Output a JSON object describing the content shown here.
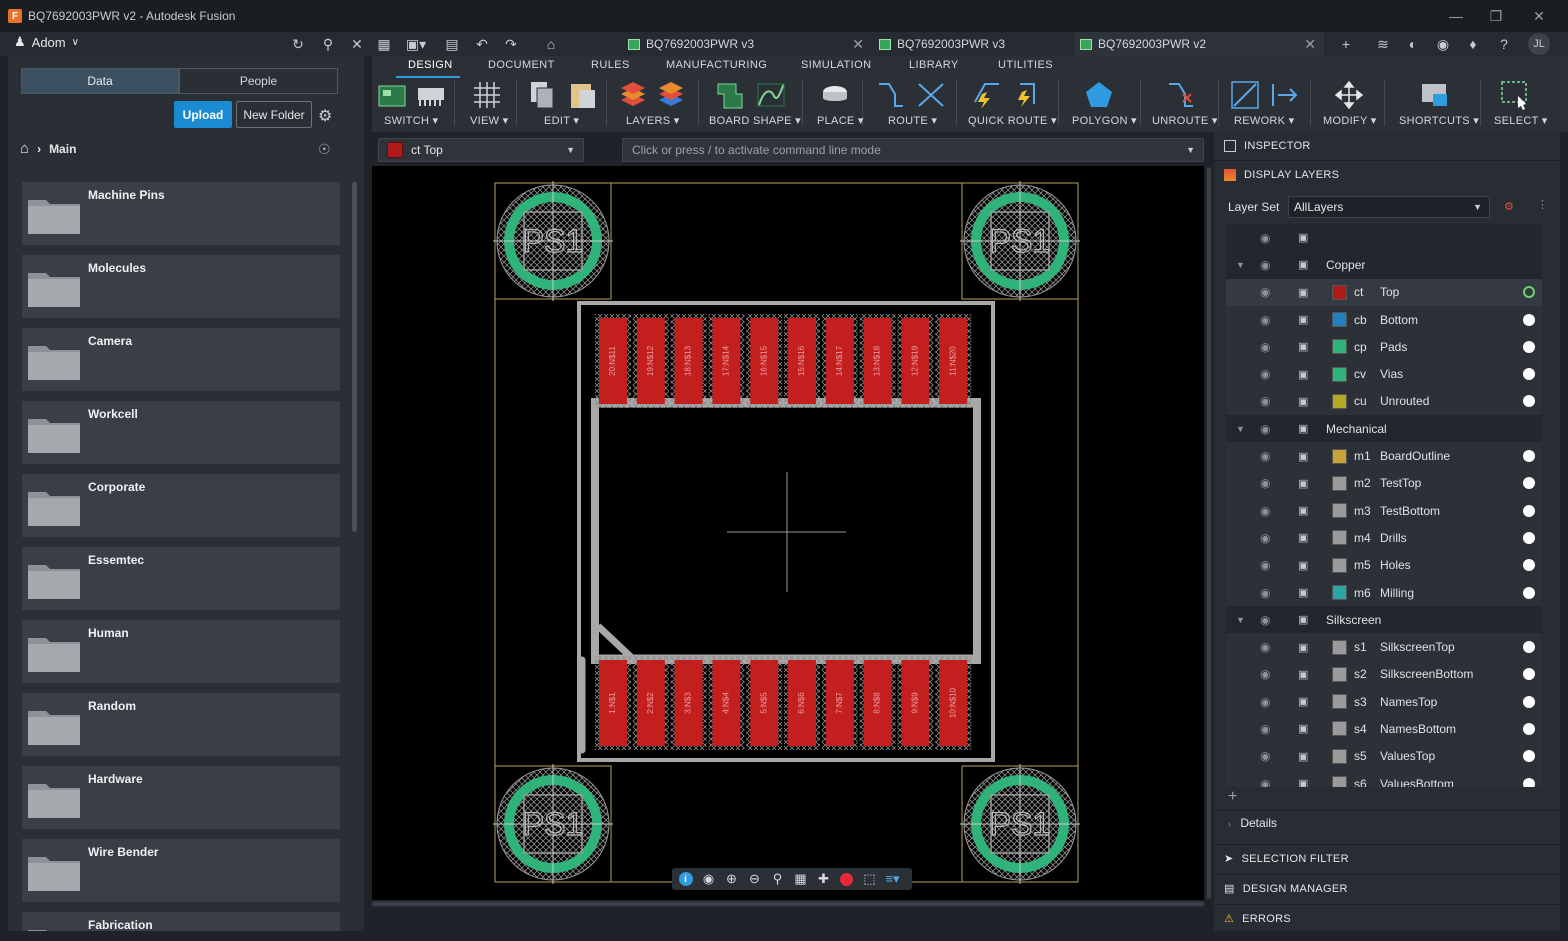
{
  "window": {
    "title": "BQ7692003PWR v2 - Autodesk Fusion"
  },
  "appbar": {
    "team": "Adom",
    "tabs": [
      {
        "label": "BQ7692003PWR v3",
        "active": false
      },
      {
        "label": "BQ7692003PWR v3",
        "active": false
      },
      {
        "label": "BQ7692003PWR v2",
        "active": true
      }
    ],
    "user_initials": "JL"
  },
  "datapanel": {
    "tab_data": "Data",
    "tab_people": "People",
    "upload": "Upload",
    "new_folder": "New Folder",
    "breadcrumb": "Main",
    "folders": [
      "Machine Pins",
      "Molecules",
      "Camera",
      "Workcell",
      "Corporate",
      "Essemtec",
      "Human",
      "Random",
      "Hardware",
      "Wire Bender",
      "Fabrication"
    ]
  },
  "ribbon": {
    "tabs": [
      "DESIGN",
      "DOCUMENT",
      "RULES",
      "MANUFACTURING",
      "SIMULATION",
      "LIBRARY",
      "UTILITIES"
    ],
    "active_tab": "DESIGN",
    "groups": [
      "SWITCH",
      "VIEW",
      "EDIT",
      "LAYERS",
      "BOARD SHAPE",
      "PLACE",
      "ROUTE",
      "QUICK ROUTE",
      "POLYGON",
      "UNROUTE",
      "REWORK",
      "MODIFY",
      "SHORTCUTS",
      "SELECT"
    ]
  },
  "toolbar": {
    "active_layer": "ct Top",
    "active_layer_color": "#b01a1a",
    "command_placeholder": "Click or press / to activate command line mode"
  },
  "canvas": {
    "pad_label": "PS1",
    "top_pins": [
      "20:N$11",
      "19:N$12",
      "18:N$13",
      "17:N$14",
      "16:N$15",
      "15:N$16",
      "14:N$17",
      "13:N$18",
      "12:N$19",
      "11:N$20"
    ],
    "bottom_pins": [
      "1:N$1",
      "2:N$2",
      "3:N$3",
      "4:N$4",
      "5:N$5",
      "6:N$6",
      "7:N$7",
      "8:N$8",
      "9:N$9",
      "10:N$10"
    ]
  },
  "inspector": {
    "inspector_title": "INSPECTOR",
    "display_layers_title": "DISPLAY LAYERS",
    "layer_set_label": "Layer Set",
    "layer_set_value": "AllLayers",
    "rows": [
      {
        "type": "header"
      },
      {
        "type": "group",
        "name": "Copper"
      },
      {
        "type": "layer",
        "abbr": "ct",
        "name": "Top",
        "color": "#b01a1a",
        "active": true
      },
      {
        "type": "layer",
        "abbr": "cb",
        "name": "Bottom",
        "color": "#1f7fc0",
        "active": false
      },
      {
        "type": "layer",
        "abbr": "cp",
        "name": "Pads",
        "color": "#2fb37a",
        "active": false
      },
      {
        "type": "layer",
        "abbr": "cv",
        "name": "Vias",
        "color": "#2fb37a",
        "active": false
      },
      {
        "type": "layer",
        "abbr": "cu",
        "name": "Unrouted",
        "color": "#b5a823",
        "active": false
      },
      {
        "type": "group",
        "name": "Mechanical"
      },
      {
        "type": "layer",
        "abbr": "m1",
        "name": "BoardOutline",
        "color": "#c9a23a",
        "active": false
      },
      {
        "type": "layer",
        "abbr": "m2",
        "name": "TestTop",
        "color": "#9a9a9a",
        "active": false
      },
      {
        "type": "layer",
        "abbr": "m3",
        "name": "TestBottom",
        "color": "#9a9a9a",
        "active": false
      },
      {
        "type": "layer",
        "abbr": "m4",
        "name": "Drills",
        "color": "#9a9a9a",
        "active": false
      },
      {
        "type": "layer",
        "abbr": "m5",
        "name": "Holes",
        "color": "#9a9a9a",
        "active": false
      },
      {
        "type": "layer",
        "abbr": "m6",
        "name": "Milling",
        "color": "#2aa6a6",
        "active": false
      },
      {
        "type": "group",
        "name": "Silkscreen"
      },
      {
        "type": "layer",
        "abbr": "s1",
        "name": "SilkscreenTop",
        "color": "#9a9a9a",
        "active": false
      },
      {
        "type": "layer",
        "abbr": "s2",
        "name": "SilkscreenBottom",
        "color": "#9a9a9a",
        "active": false
      },
      {
        "type": "layer",
        "abbr": "s3",
        "name": "NamesTop",
        "color": "#9a9a9a",
        "active": false
      },
      {
        "type": "layer",
        "abbr": "s4",
        "name": "NamesBottom",
        "color": "#9a9a9a",
        "active": false
      },
      {
        "type": "layer",
        "abbr": "s5",
        "name": "ValuesTop",
        "color": "#9a9a9a",
        "active": false
      },
      {
        "type": "layer",
        "abbr": "s6",
        "name": "ValuesBottom",
        "color": "#9a9a9a",
        "active": false
      }
    ],
    "details_label": "Details",
    "selection_filter": "SELECTION FILTER",
    "design_manager": "DESIGN MANAGER",
    "errors": "ERRORS"
  }
}
